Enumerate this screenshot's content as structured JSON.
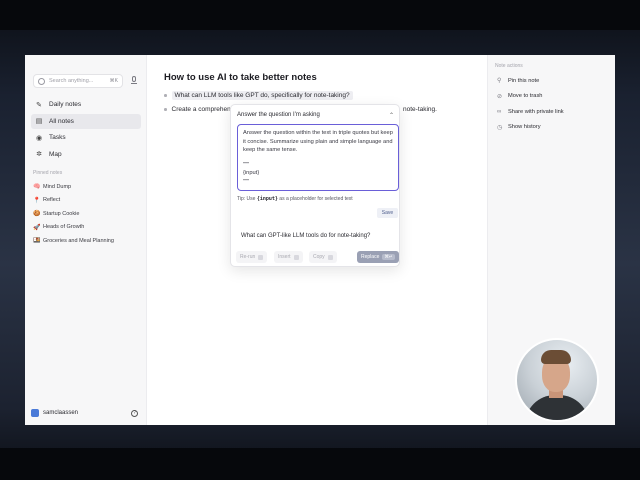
{
  "sidebar": {
    "search_placeholder": "Search anything...",
    "search_shortcut": "⌘K",
    "nav": [
      {
        "label": "Daily notes",
        "icon": "pencil-icon"
      },
      {
        "label": "All notes",
        "icon": "notes-icon"
      },
      {
        "label": "Tasks",
        "icon": "check-circle-icon"
      },
      {
        "label": "Map",
        "icon": "map-icon"
      }
    ],
    "pinned_title": "Pinned notes",
    "pinned": [
      {
        "emoji": "🧠",
        "label": "Mind Dump"
      },
      {
        "emoji": "📍",
        "label": "Reflect"
      },
      {
        "emoji": "🍪",
        "label": "Startup Cookie"
      },
      {
        "emoji": "🚀",
        "label": "Heads of Growth"
      },
      {
        "emoji": "🍱",
        "label": "Groceries and Meal Planning"
      }
    ],
    "user_name": "samclaassen",
    "help_label": "?"
  },
  "main": {
    "title": "How to use AI to take better notes",
    "bullet1": "What can LLM tools like GPT do, specifically for note-taking?",
    "bullet2_start": "Create a comprehen",
    "bullet2_end": "note-taking."
  },
  "popup": {
    "header": "Answer the question I'm asking",
    "prompt_text": "Answer the question within the text in triple quotes but keep it concise. Summarize using plain and simple language and keep the same tense.",
    "prompt_sep_open": "\"\"\"",
    "prompt_placeholder": "{input}",
    "prompt_sep_close": "\"\"\"",
    "tip_prefix": "Tip: Use",
    "tip_code": "{input}",
    "tip_suffix": "as a placeholder for selected text",
    "save_label": "Save",
    "answer": "What can GPT-like LLM tools do for note-taking?",
    "actions": {
      "rerun": "Re-run",
      "insert": "Insert",
      "copy": "Copy",
      "replace": "Replace",
      "replace_shortcut": "⌘↵"
    }
  },
  "right_panel": {
    "title": "Note actions",
    "items": [
      {
        "label": "Pin this note",
        "icon": "pin-icon"
      },
      {
        "label": "Move to trash",
        "icon": "trash-icon"
      },
      {
        "label": "Share with private link",
        "icon": "link-icon"
      },
      {
        "label": "Show history",
        "icon": "history-icon"
      }
    ]
  }
}
